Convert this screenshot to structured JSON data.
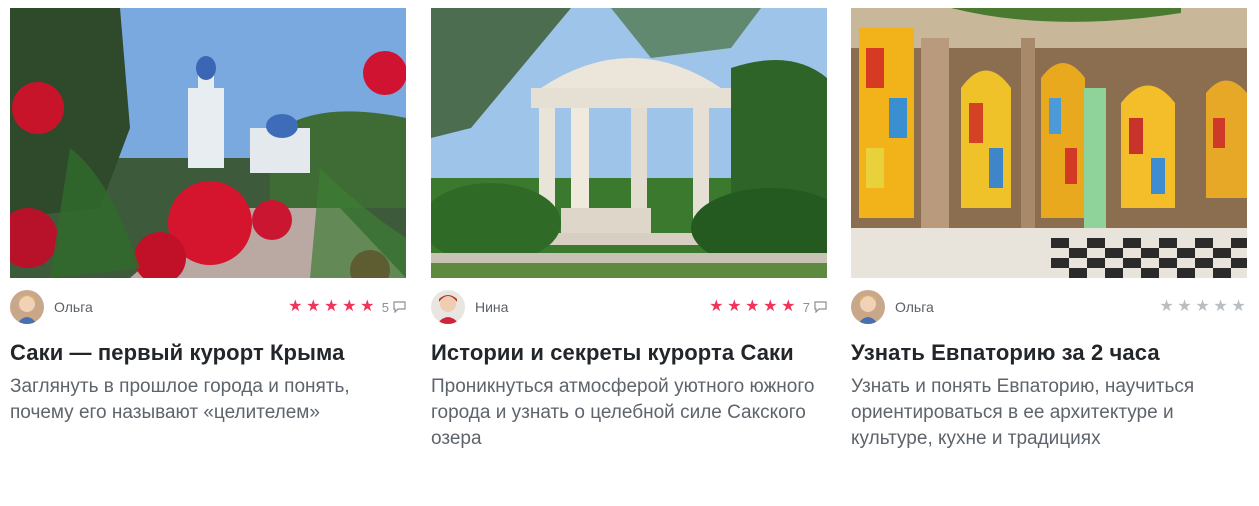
{
  "cards": [
    {
      "author": "Ольга",
      "rating": 5,
      "reviews_count": "5",
      "title": "Саки — первый курорт Крыма",
      "description": "Заглянуть в прошлое города и понять, почему его называют «целителем»"
    },
    {
      "author": "Нина",
      "rating": 5,
      "reviews_count": "7",
      "title": "Истории и секреты курорта Саки",
      "description": "Проникнуться атмосферой уютного южного города и узнать о целебной силе Сакского озера"
    },
    {
      "author": "Ольга",
      "rating": 0,
      "reviews_count": "",
      "title": "Узнать Евпаторию за 2 часа",
      "description": "Узнать и понять Евпаторию, научиться ориентироваться в ее архитектуре и культуре, кухне и традициях"
    }
  ],
  "colors": {
    "star_active": "#f0345a",
    "star_inactive": "#b9bec3",
    "title_text": "#22262a",
    "description_text": "#5d646b"
  }
}
